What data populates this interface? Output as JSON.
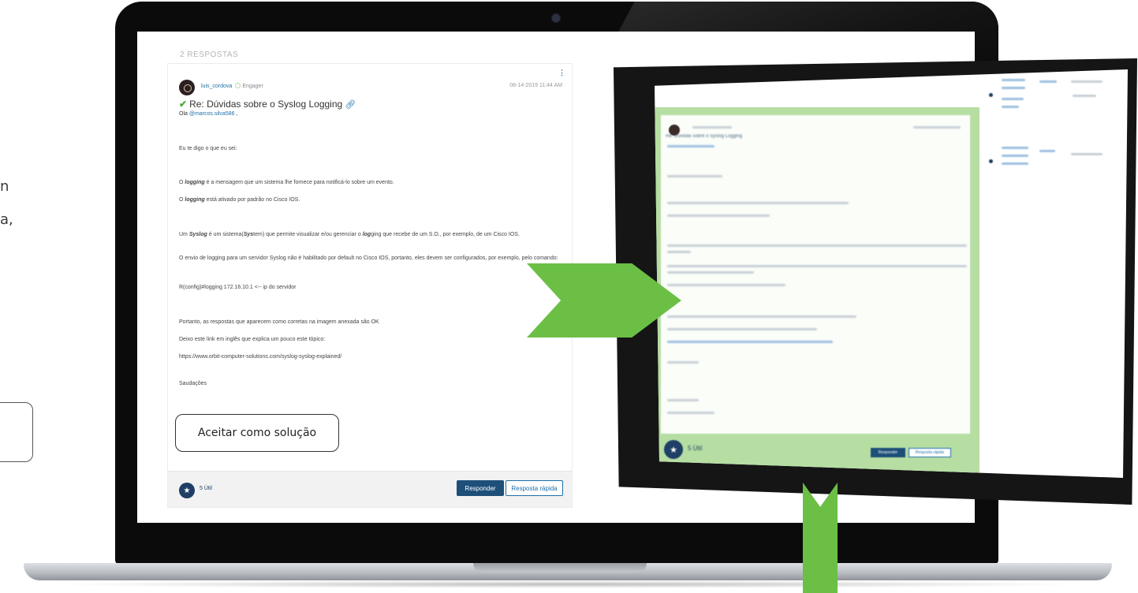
{
  "left_fragments": [
    "n",
    "a,"
  ],
  "forum": {
    "replies_header": "2 RESPOSTAS",
    "post": {
      "author": "luis_cordova",
      "rank": "Engager",
      "date": "08-14-2019 11:44 AM",
      "kebab": "⋮",
      "title": "Re: Dúvidas sobre o Syslog Logging",
      "greeting_prefix": "Ola ",
      "mention": "@marcos.silva586",
      "greeting_suffix": " ,",
      "p1": "Eu te digo o que eu sei:",
      "p2_pre": "O ",
      "p2_bold": "logging",
      "p2_post": " é a mensagem que um sistema lhe fornece para notificá-lo sobre um evento.",
      "p3_pre": "O ",
      "p3_bold": "logging",
      "p3_post": " está ativado por padrão no Cisco IOS.",
      "p4_a": "Um ",
      "p4_b": "Syslog",
      "p4_c": " é um sistema(",
      "p4_d": "Sys",
      "p4_e": "tem) que permite visualizar e/ou gerenciar o ",
      "p4_f": "log",
      "p4_g": "ging que recebe de um S.O., por exemplo, de um Cisco IOS.",
      "p5": "O envio de logging para um servidor Syslog não é habilitado por default no Cisco IOS, portanto, eles devem ser configurados, por exemplo, pelo comando:",
      "p6": "R(config)#logging 172.16.10.1 <-- ip do servidor",
      "p7": "Portanto, as respostas que aparecem como corretas na imagem anexada são OK",
      "p8": "Deixo este link em inglês que explica um pouco este tópico:",
      "link": "https://www.orbit-computer-solutions.com/syslog-syslog-explained/",
      "closing": "Saudações",
      "accept_label": "Aceitar como solução",
      "kudos": "5 Útil",
      "reply_label": "Responder",
      "quick_reply_label": "Resposta rápida"
    }
  },
  "inset": {
    "kudos": "5 Útil",
    "title": "Re: Dúvidas sobre o Syslog Logging",
    "reply_label": "Responder",
    "quick_reply_label": "Resposta rápida"
  },
  "colors": {
    "arrow": "#6cbf45",
    "link": "#1e6fa8",
    "primary_button": "#1d4f78",
    "solved_check": "#54a83b",
    "inset_highlight": "#b6dea3"
  },
  "icons": [
    "check-icon",
    "link-icon",
    "star-kudos-icon",
    "kebab-menu-icon",
    "rank-icon",
    "arrow-right-icon",
    "arrow-down-icon"
  ]
}
